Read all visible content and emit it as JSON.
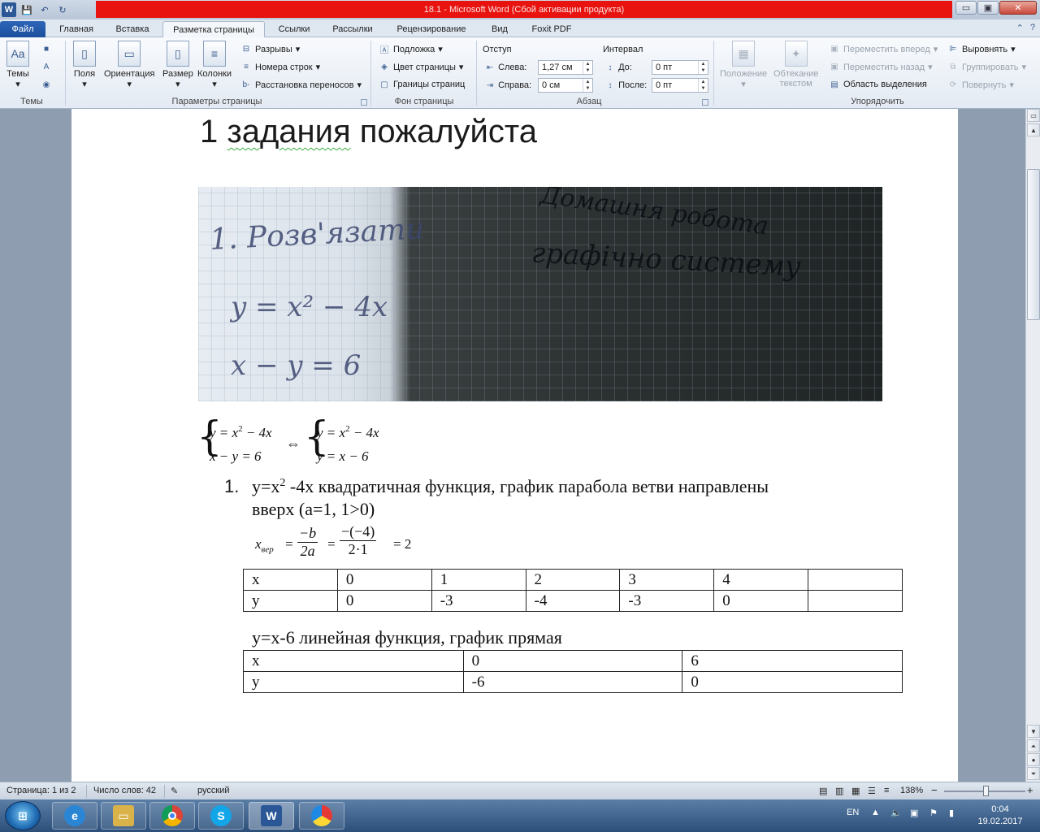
{
  "window": {
    "title": "18.1 - Microsoft Word (Сбой активации продукта)",
    "minimize": "▭",
    "maximize": "▣",
    "close": "✕"
  },
  "qat": {
    "word_logo": "W",
    "save": "💾",
    "undo": "↶",
    "redo": "↻"
  },
  "tabs": {
    "file": "Файл",
    "items": [
      "Главная",
      "Вставка",
      "Разметка страницы",
      "Ссылки",
      "Рассылки",
      "Рецензирование",
      "Вид",
      "Foxit PDF"
    ],
    "right_icons": [
      "⌃",
      "?"
    ]
  },
  "ribbon": {
    "themes": {
      "label": "Темы",
      "group": "Темы"
    },
    "page_setup": {
      "group": "Параметры страницы",
      "fields": "Поля",
      "orientation": "Ориентация",
      "size": "Размер",
      "columns": "Колонки",
      "breaks": "Разрывы",
      "line_numbers": "Номера строк",
      "hyphenation": "Расстановка переносов"
    },
    "background": {
      "group": "Фон страницы",
      "watermark": "Подложка",
      "page_color": "Цвет страницы",
      "page_borders": "Границы страниц"
    },
    "paragraph": {
      "group": "Абзац",
      "indent": "Отступ",
      "left_label": "Слева:",
      "left_value": "1,27 см",
      "right_label": "Справа:",
      "right_value": "0 см",
      "spacing": "Интервал",
      "before_label": "До:",
      "before_value": "0 пт",
      "after_label": "После:",
      "after_value": "0 пт"
    },
    "arrange": {
      "group": "Упорядочить",
      "position": "Положение",
      "wrap": "Обтекание",
      "wrap2": "текстом",
      "bring_forward": "Переместить вперед",
      "send_backward": "Переместить назад",
      "selection_pane": "Область выделения",
      "align": "Выровнять",
      "group_btn": "Группировать",
      "rotate": "Повернуть"
    }
  },
  "document": {
    "heading_prefix": "1 ",
    "heading_squiggle": "задания",
    "heading_rest": " пожалуйста",
    "photo_lines": {
      "line1": "1. Розв'язати",
      "line1b": "графічно систему",
      "line_top": "Домашня робота",
      "sys1": "y = x² − 4x",
      "sys2": "x − y = 6"
    },
    "system": {
      "left1": "y = x",
      "left1_exp": "2",
      "left1_rest": " − 4x",
      "left2": "x − y = 6",
      "equiv": "⇔",
      "right1": "y = x",
      "right1_exp": "2",
      "right1_rest": " − 4x",
      "right2": "y = x − 6"
    },
    "item1": {
      "number": "1.",
      "line1_a": "y=x",
      "line1_sup": "2",
      "line1_b": " -4x квадратичная функция, график парабола ветви направлены",
      "line2": "вверх (a=1, 1>0)"
    },
    "vertex": {
      "lhs": "x",
      "lhs_sub": "вер",
      "eq": "=",
      "f1_num": "−b",
      "f1_den": "2a",
      "f2_num": "−(−4)",
      "f2_den": "2·1",
      "result": "= 2"
    },
    "table1": {
      "rows": [
        [
          "x",
          "0",
          "1",
          "2",
          "3",
          "4",
          ""
        ],
        [
          "y",
          "0",
          "-3",
          "-4",
          "-3",
          "0",
          ""
        ]
      ]
    },
    "linear_line": "y=x-6 линейная функция, график прямая",
    "table2": {
      "rows": [
        [
          "x",
          "0",
          "6"
        ],
        [
          "y",
          "-6",
          "0"
        ]
      ]
    }
  },
  "statusbar": {
    "page": "Страница: 1 из 2",
    "words": "Число слов: 42",
    "language": "русский",
    "zoom": "138%",
    "zoom_minus": "−",
    "zoom_plus": "+"
  },
  "taskbar": {
    "start": "⊞",
    "lang": "EN",
    "time": "0:04",
    "date": "19.02.2017"
  }
}
